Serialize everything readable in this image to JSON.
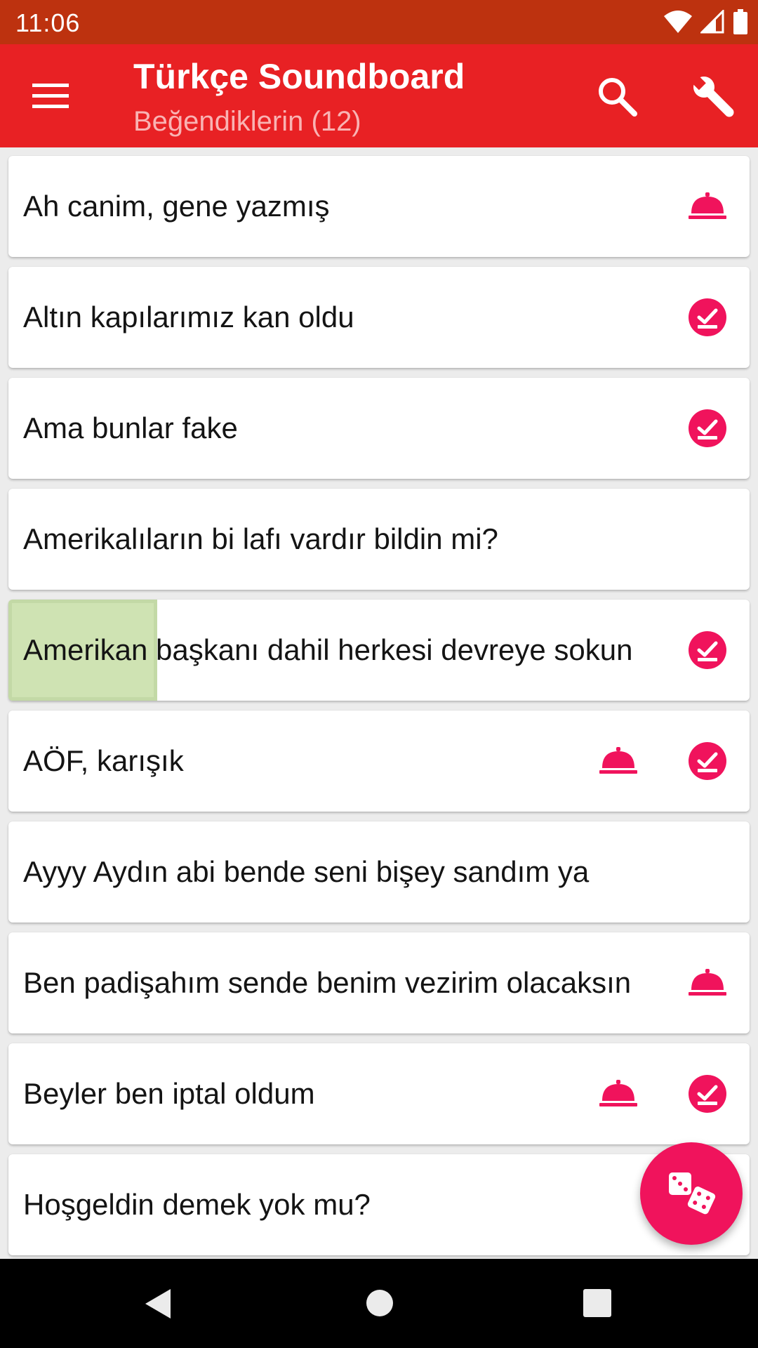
{
  "status_bar": {
    "time": "11:06",
    "icons": [
      "wifi-icon",
      "signal-icon",
      "battery-icon"
    ]
  },
  "app_bar": {
    "title": "Türkçe Soundboard",
    "subtitle": "Beğendiklerin (12)",
    "icons": {
      "menu": "menu-icon",
      "search": "search-icon",
      "settings": "wrench-icon"
    }
  },
  "colors": {
    "status_bar": "#bd320f",
    "app_bar": "#e82124",
    "accent": "#f0135c",
    "highlight": "#cfe3b3"
  },
  "sounds": [
    {
      "label": "Ah canim, gene yazmış",
      "bell": true,
      "check": false
    },
    {
      "label": "Altın kapılarımız kan oldu",
      "bell": false,
      "check": true
    },
    {
      "label": "Ama bunlar fake",
      "bell": false,
      "check": true
    },
    {
      "label": "Amerikalıların bi lafı vardır bildin mi?",
      "bell": false,
      "check": false
    },
    {
      "label": "Amerikan başkanı dahil herkesi devreye sokun",
      "bell": false,
      "check": true,
      "pressed": true
    },
    {
      "label": "AÖF, karışık",
      "bell": true,
      "check": true
    },
    {
      "label": "Ayyy Aydın abi bende seni bişey sandım ya",
      "bell": false,
      "check": false
    },
    {
      "label": "Ben padişahım sende benim vezirim olacaksın",
      "bell": true,
      "check": false
    },
    {
      "label": "Beyler ben iptal oldum",
      "bell": true,
      "check": true
    },
    {
      "label": "Hoşgeldin demek yok mu?",
      "bell": false,
      "check": false
    }
  ],
  "fab": {
    "icon": "dice-icon"
  },
  "nav_bar": {
    "icons": [
      "back-icon",
      "home-icon",
      "recents-icon"
    ]
  }
}
